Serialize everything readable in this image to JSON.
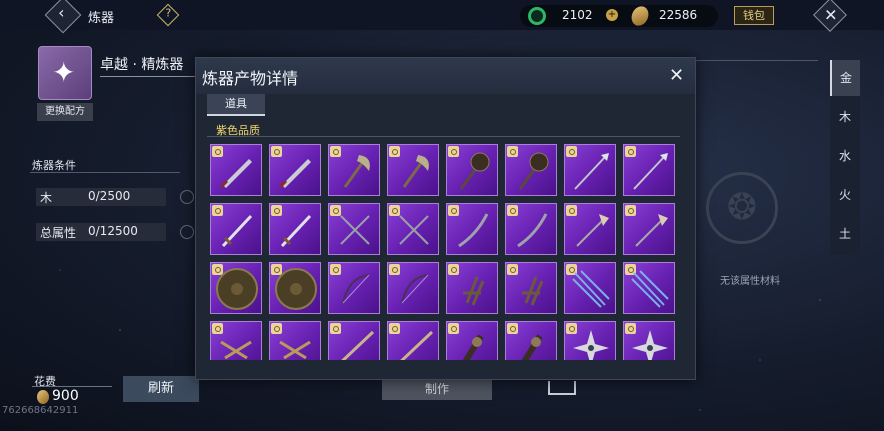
{
  "top_bar": {
    "title": "炼器",
    "jade_amount": "2102",
    "gold_amount": "22586",
    "wallet_label": "钱包",
    "plus_symbol": "+"
  },
  "recipe": {
    "name": "卓越 · 精炼器",
    "change_label": "更换配方"
  },
  "conditions": {
    "title": "炼器条件",
    "rows": [
      {
        "label": "木",
        "value": "0/2500"
      },
      {
        "label": "总属性",
        "value": "0/12500"
      }
    ]
  },
  "cost": {
    "label": "花费",
    "value": "900"
  },
  "refresh_label": "刷新",
  "make_label": "制作",
  "uid": "762668642911",
  "no_attribute_text": "无该属性材料",
  "elements": [
    "金",
    "木",
    "水",
    "火",
    "土"
  ],
  "dialog": {
    "title": "炼器产物详情",
    "tab_label": "道具",
    "quality_label": "紫色品质",
    "items": [
      "blade",
      "blade",
      "axe",
      "axe",
      "mace",
      "mace",
      "spear",
      "spear",
      "sword",
      "sword",
      "crossed-daggers",
      "crossed-daggers",
      "saber",
      "saber",
      "halberd",
      "halberd",
      "shield",
      "shield",
      "bow",
      "bow",
      "claw",
      "claw",
      "arrows",
      "arrows",
      "twin-pistols",
      "twin-pistols",
      "rifle",
      "rifle",
      "gauntlet",
      "gauntlet",
      "shuriken",
      "shuriken"
    ]
  },
  "colors": {
    "purple_cell": "#7a2fca",
    "quality_gold": "#f3d86b",
    "jade": "#2fb56b"
  }
}
